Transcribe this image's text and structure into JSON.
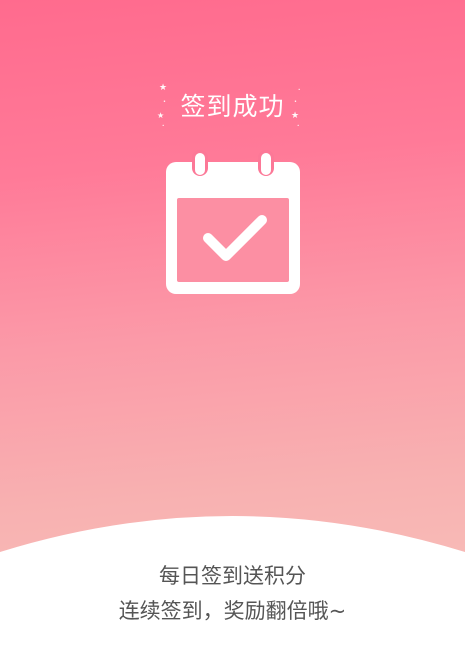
{
  "header": {
    "title": "签到成功"
  },
  "icon": {
    "name": "calendar-check-icon"
  },
  "footer": {
    "line1": "每日签到送积分",
    "line2": "连续签到，奖励翻倍哦~"
  },
  "colors": {
    "gradient_top": "#ff6b8e",
    "gradient_bottom": "#f7c5bd",
    "footer_text": "#555555"
  }
}
